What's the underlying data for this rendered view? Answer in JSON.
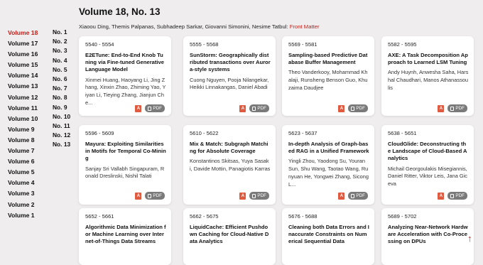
{
  "header": {
    "title": "Volume 18, No. 13",
    "front_matter_authors": "Xiaoou Ding, Themis Palpanas, Subhadeep Sarkar, Giovanni Simonini, Nesime Tatbul:",
    "front_matter_link": "Front Matter"
  },
  "volumes": [
    "Volume 18",
    "Volume 17",
    "Volume 16",
    "Volume 15",
    "Volume 14",
    "Volume 13",
    "Volume 12",
    "Volume 11",
    "Volume 10",
    "Volume 9",
    "Volume 8",
    "Volume 7",
    "Volume 6",
    "Volume 5",
    "Volume 4",
    "Volume 3",
    "Volume 2",
    "Volume 1"
  ],
  "active_volume": "Volume 18",
  "numbers": [
    "No. 1",
    "No. 2",
    "No. 3",
    "No. 4",
    "No. 5",
    "No. 6",
    "No. 7",
    "No. 8",
    "No. 9",
    "No. 10",
    "No. 11",
    "No. 12",
    "No. 13"
  ],
  "pdf_label": "PDF",
  "acrobat_glyph": "A",
  "scroll_top_icon": "↑",
  "papers": [
    {
      "pages": "5540 - 5554",
      "title": "E2ETune: End-to-End Knob Tuning via Fine-tuned Generative Language Model",
      "authors": "Xinmei Huang, Haoyang Li, Jing Zhang, Xinxin Zhao, Zhiming Yao, Yiyan Li, Tieying Zhang, Jianjun Che..."
    },
    {
      "pages": "5555 - 5568",
      "title": "SunStorm: Geographically distributed transactions over Aurora-style systems",
      "authors": "Cuong Nguyen, Pooja Nilangekar, Heikki Linnakangas, Daniel Abadi"
    },
    {
      "pages": "5569 - 5581",
      "title": "Sampling-based Predictive Database Buffer Management",
      "authors": "Theo Vanderkooy, Mohammad Khalaji, Runsheng Benson Guo, Khuzaima Daudjee"
    },
    {
      "pages": "5582 - 5595",
      "title": "AXE: A Task Decomposition Approach to Learned LSM Tuning",
      "authors": "Andy Huynh, Anwesha Saha, Harshal Chaudhari, Manos Athanassoulis"
    },
    {
      "pages": "5596 - 5609",
      "title": "Mayura: Exploiting Similarities in Motifs for Temporal Co-Mining",
      "authors": "Sanjay Sri Vallabh Singapuram, Ronald Dreslinski, Nishil Talati"
    },
    {
      "pages": "5610 - 5622",
      "title": "Mix & Match: Subgraph Matching for Absolute Coverage",
      "authors": "Konstantinos Skitsas, Yuya Sasaki, Davide Mottin, Panagiotis Karras"
    },
    {
      "pages": "5623 - 5637",
      "title": "In-depth Analysis of Graph-based RAG in a Unified Framework",
      "authors": "Yingli Zhou, Yaodong Su, Youran Sun, Shu Wang, Taotao Wang, Runyuan He, Yongwei Zhang, Sicong L..."
    },
    {
      "pages": "5638 - 5651",
      "title": "CloudGlide: Deconstructing the Landscape of Cloud-Based Analytics",
      "authors": "Michail Georgoulakis Misegiannis, Daniel Ritter, Viktor Leis, Jana Giceva"
    },
    {
      "pages": "5652 - 5661",
      "title": "Algorithmic Data Minimization for Machine Learning over Internet-of-Things Data Streams",
      "authors": ""
    },
    {
      "pages": "5662 - 5675",
      "title": "LiquidCache: Efficient Pushdown Caching for Cloud-Native Data Analytics",
      "authors": ""
    },
    {
      "pages": "5676 - 5688",
      "title": "Cleaning both Data Errors and Inaccurate Constraints on Numerical Sequential Data",
      "authors": ""
    },
    {
      "pages": "5689 - 5702",
      "title": "Analyzing Near-Network Hardware Acceleration with Co-Processing on DPUs",
      "authors": ""
    }
  ]
}
